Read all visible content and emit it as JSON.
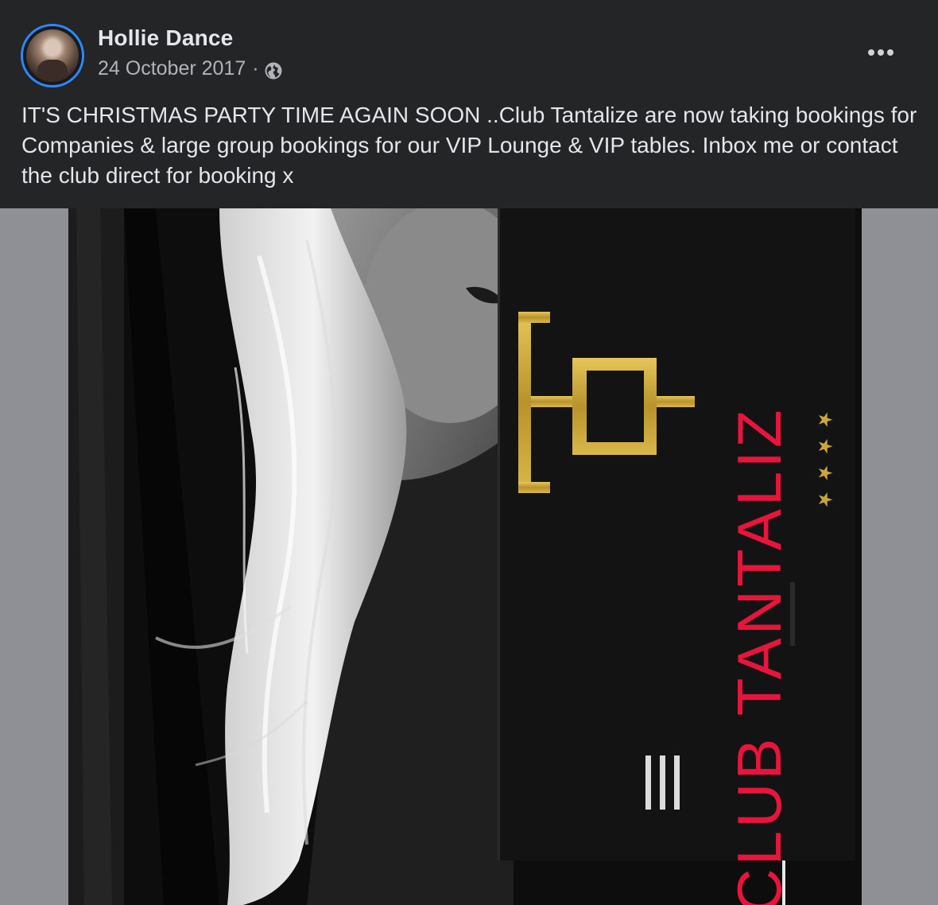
{
  "post": {
    "author": "Hollie Dance",
    "date": "24 October 2017",
    "separator": "·",
    "audience_icon": "globe-icon",
    "more_icon": "more-options-icon",
    "text": "IT'S CHRISTMAS PARTY TIME AGAIN SOON ..Club Tantalize are now taking bookings for Companies & large group bookings for our VIP Lounge & VIP tables. Inbox me or contact the club direct for booking x"
  },
  "image": {
    "sign_text": "CLUB TANTALIZ",
    "stars": "★★★★",
    "colors": {
      "logo_gold": "#c9a63a",
      "sign_red": "#e8143c"
    }
  },
  "colors": {
    "card_background": "#242526",
    "primary_text": "#e4e6eb",
    "secondary_text": "#b0b3b8",
    "avatar_ring": "#2d88ff",
    "media_backdrop": "#8e9095"
  }
}
